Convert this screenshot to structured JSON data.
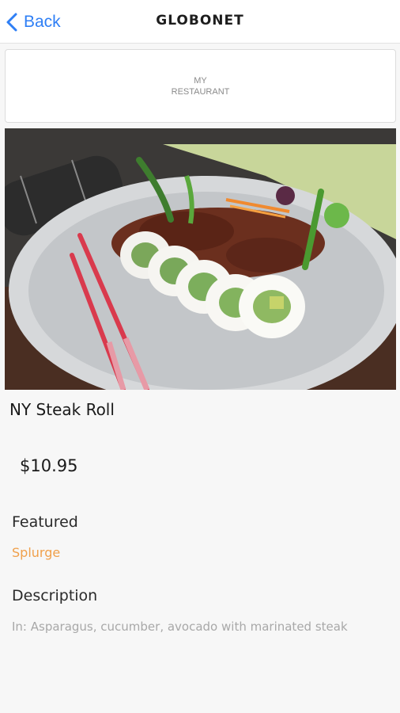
{
  "nav": {
    "back_label": "Back",
    "brand": "GLOBONET"
  },
  "restaurant": {
    "name_line1": "MY",
    "name_line2": "RESTAURANT"
  },
  "photo": {
    "icon": "food-photo"
  },
  "item": {
    "name": "NY Steak Roll",
    "price": "$10.95"
  },
  "featured": {
    "heading": "Featured",
    "value": "Splurge"
  },
  "description": {
    "heading": "Description",
    "text": "In: Asparagus, cucumber, avocado with marinated steak"
  },
  "colors": {
    "accent_blue": "#2f7ff5",
    "featured_orange": "#f0a04b"
  }
}
